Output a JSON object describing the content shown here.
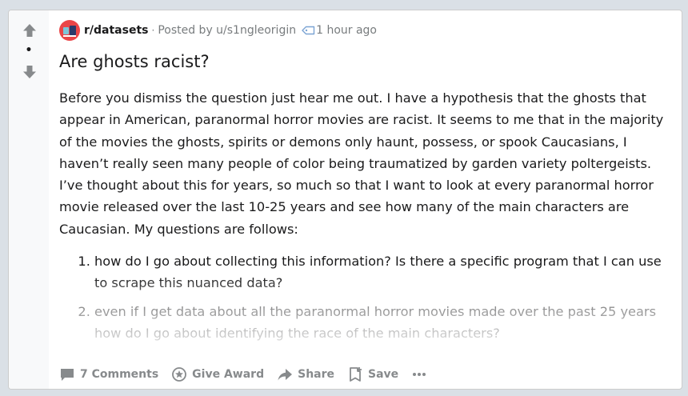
{
  "post": {
    "vote": {
      "score": "•",
      "upvote_icon": "arrow-up-icon",
      "downvote_icon": "arrow-down-icon"
    },
    "meta": {
      "subreddit": "r/datasets",
      "separator": "·",
      "posted_by": "Posted by u/s1ngleorigin",
      "time": "1 hour ago"
    },
    "title": "Are ghosts racist?",
    "body": "Before you dismiss the question just hear me out. I have a hypothesis that the ghosts that appear in American, paranormal horror movies are racist. It seems to me that in the majority of the movies the ghosts, spirits or demons only haunt, possess, or spook Caucasians, I haven’t really seen many people of color being traumatized by garden variety poltergeists. I’ve thought about this for years, so much so that I want to look at every paranormal horror movie released over the last 10-25 years and see how many of the main characters are Caucasian. My questions are follows:",
    "questions": [
      "how do I go about collecting this information? Is there a specific program that I can use to scrape this nuanced data?",
      "even if I get data about all the paranormal horror movies made over the past 25 years how do I go about identifying the race of the main characters?"
    ],
    "actions": {
      "comments": "7 Comments",
      "award": "Give Award",
      "share": "Share",
      "save": "Save"
    }
  },
  "colors": {
    "page_bg": "#dae0e6",
    "vote_col_bg": "#f8f9fa",
    "text": "#1a1a1b",
    "muted": "#787c7e",
    "action": "#878a8c",
    "avatar_bg": "#ea4547"
  }
}
